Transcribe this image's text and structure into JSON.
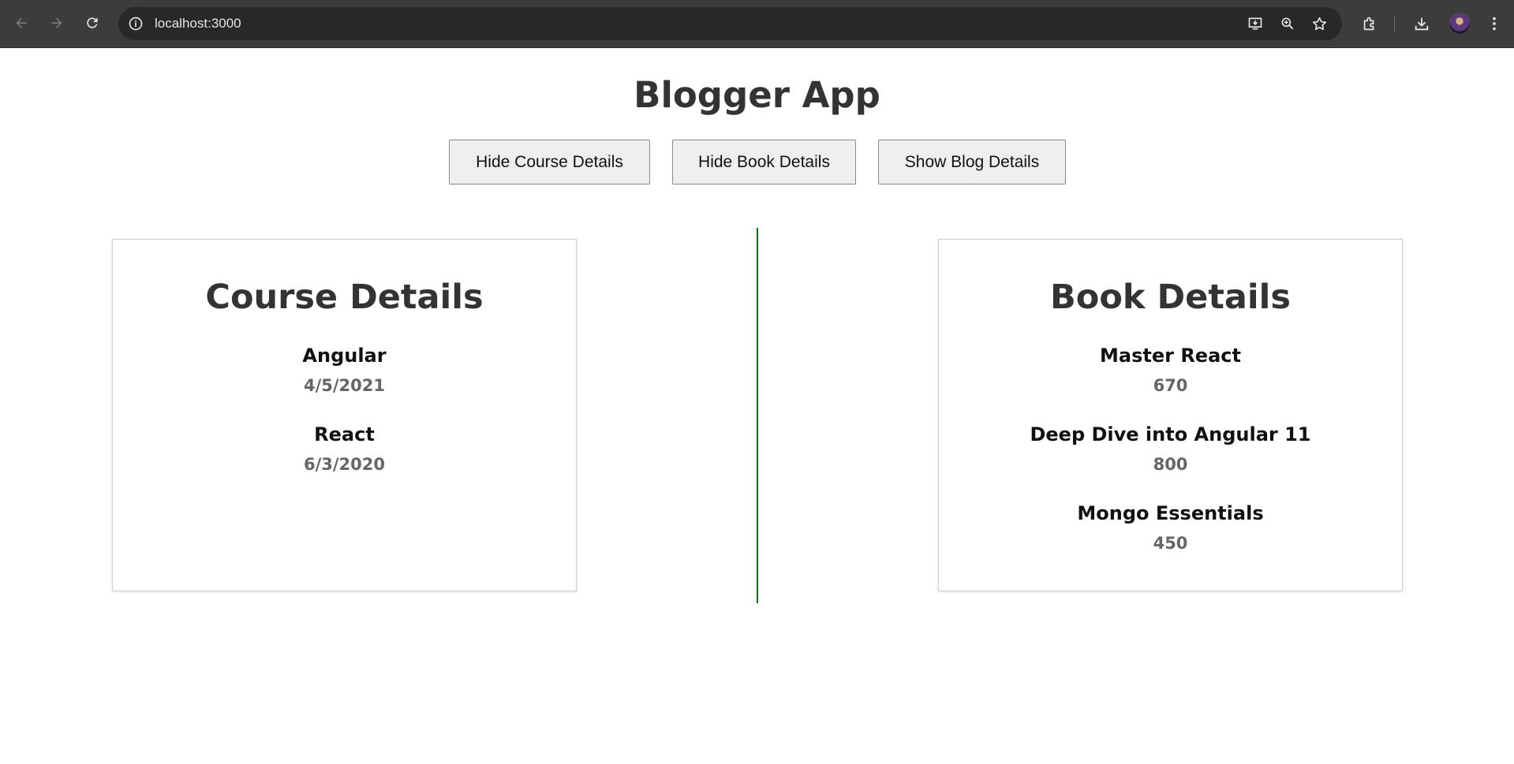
{
  "browser": {
    "url": "localhost:3000",
    "icons": [
      "back-icon",
      "forward-icon",
      "reload-icon",
      "site-info-icon",
      "install-app-icon",
      "zoom-icon",
      "bookmark-star-icon",
      "extensions-icon",
      "download-icon",
      "profile-avatar",
      "menu-icon"
    ]
  },
  "app": {
    "title": "Blogger App",
    "buttons": {
      "course": "Hide Course Details",
      "book": "Hide Book Details",
      "blog": "Show Blog Details"
    }
  },
  "course_details": {
    "heading": "Course Details",
    "items": [
      {
        "name": "Angular",
        "date": "4/5/2021"
      },
      {
        "name": "React",
        "date": "6/3/2020"
      }
    ]
  },
  "book_details": {
    "heading": "Book Details",
    "items": [
      {
        "name": "Master React",
        "price": "670"
      },
      {
        "name": "Deep Dive into Angular 11",
        "price": "800"
      },
      {
        "name": "Mongo Essentials",
        "price": "450"
      }
    ]
  },
  "colors": {
    "divider": "#0b6b1c",
    "chrome_bg": "#3c3c3c",
    "omnibox_bg": "#282828"
  }
}
